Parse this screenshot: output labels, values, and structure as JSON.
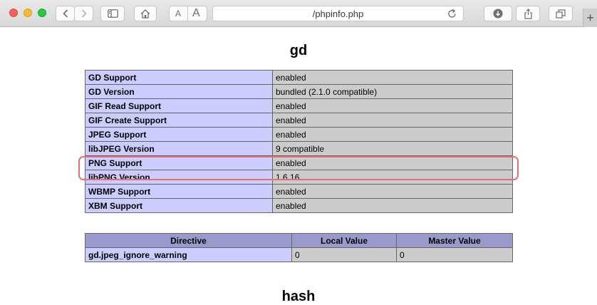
{
  "browser": {
    "url": "/phpinfo.php",
    "font_small": "A",
    "font_large": "A",
    "new_tab": "+",
    "icons": [
      "back-icon",
      "forward-icon",
      "sidebar-icon",
      "home-icon",
      "reload-icon",
      "downloads-icon",
      "share-icon",
      "tabs-icon",
      "plus-icon"
    ]
  },
  "gd": {
    "title": "gd",
    "rows": [
      {
        "key": "GD Support",
        "value": "enabled"
      },
      {
        "key": "GD Version",
        "value": "bundled (2.1.0 compatible)"
      },
      {
        "key": "GIF Read Support",
        "value": "enabled"
      },
      {
        "key": "GIF Create Support",
        "value": "enabled"
      },
      {
        "key": "JPEG Support",
        "value": "enabled"
      },
      {
        "key": "libJPEG Version",
        "value": "9 compatible"
      },
      {
        "key": "PNG Support",
        "value": "enabled"
      },
      {
        "key": "libPNG Version",
        "value": "1.6.16"
      },
      {
        "key": "WBMP Support",
        "value": "enabled"
      },
      {
        "key": "XBM Support",
        "value": "enabled"
      }
    ],
    "directives": {
      "headers": [
        "Directive",
        "Local Value",
        "Master Value"
      ],
      "rows": [
        {
          "directive": "gd.jpeg_ignore_warning",
          "local": "0",
          "master": "0"
        }
      ]
    }
  },
  "hash": {
    "title": "hash"
  },
  "colors": {
    "key_cell": "#ccccff",
    "value_cell": "#cccccc",
    "header_cell": "#9999cc",
    "highlight": "#e67070"
  }
}
